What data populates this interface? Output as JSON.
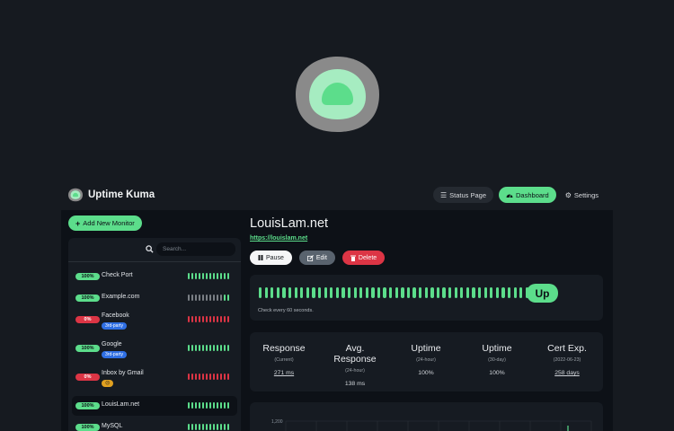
{
  "app": {
    "name": "Uptime Kuma"
  },
  "nav": {
    "status_page": "Status Page",
    "dashboard": "Dashboard",
    "settings": "Settings"
  },
  "sidebar": {
    "add_button": "Add New Monitor",
    "search_placeholder": "Search...",
    "monitors": [
      {
        "name": "Check Port",
        "uptime": "100%",
        "status": "up",
        "tag": null,
        "bars": [
          "up",
          "up",
          "up",
          "up",
          "up",
          "up",
          "up",
          "up",
          "up",
          "up",
          "up",
          "up"
        ]
      },
      {
        "name": "Example.com",
        "uptime": "100%",
        "status": "up",
        "tag": null,
        "bars": [
          "gray",
          "gray",
          "gray",
          "gray",
          "gray",
          "gray",
          "gray",
          "gray",
          "gray",
          "gray",
          "up",
          "up"
        ]
      },
      {
        "name": "Facebook",
        "uptime": "0%",
        "status": "down",
        "tag": {
          "label": "3rd-party",
          "color": "#2f6fe4"
        },
        "bars": [
          "down",
          "down",
          "down",
          "down",
          "down",
          "down",
          "down",
          "down",
          "down",
          "down",
          "down",
          "down"
        ]
      },
      {
        "name": "Google",
        "uptime": "100%",
        "status": "up",
        "tag": {
          "label": "3rd-party",
          "color": "#2f6fe4"
        },
        "bars": [
          "up",
          "up",
          "up",
          "up",
          "up",
          "up",
          "up",
          "up",
          "up",
          "up",
          "up",
          "up"
        ]
      },
      {
        "name": "Inbox by Gmail",
        "uptime": "0%",
        "status": "down",
        "tag": {
          "label": "☹",
          "color": "#e0a020"
        },
        "bars": [
          "down",
          "down",
          "down",
          "down",
          "down",
          "down",
          "down",
          "down",
          "down",
          "down",
          "down",
          "down"
        ]
      },
      {
        "name": "LouisLam.net",
        "uptime": "100%",
        "status": "up",
        "tag": null,
        "active": true,
        "bars": [
          "up",
          "up",
          "up",
          "up",
          "up",
          "up",
          "up",
          "up",
          "up",
          "up",
          "up",
          "up"
        ]
      },
      {
        "name": "MySQL",
        "uptime": "100%",
        "status": "up",
        "tag": null,
        "bars": [
          "up",
          "up",
          "up",
          "up",
          "up",
          "up",
          "up",
          "up",
          "up",
          "up",
          "up",
          "up"
        ]
      }
    ]
  },
  "detail": {
    "title": "LouisLam.net",
    "url": "https://louislam.net",
    "buttons": {
      "pause": "Pause",
      "edit": "Edit",
      "delete": "Delete"
    },
    "status": "Up",
    "check_note": "Check every 60 seconds.",
    "heartbeat_count": 50,
    "stats": [
      {
        "title": "Response",
        "sub": "(Current)",
        "value": "271 ms",
        "link": true
      },
      {
        "title": "Avg. Response",
        "sub": "(24-hour)",
        "value": "138 ms",
        "link": false
      },
      {
        "title": "Uptime",
        "sub": "(24-hour)",
        "value": "100%",
        "link": false
      },
      {
        "title": "Uptime",
        "sub": "(30-day)",
        "value": "100%",
        "link": false
      },
      {
        "title": "Cert Exp.",
        "sub": "(2022-06-23)",
        "value": "258 days",
        "link": true
      }
    ],
    "chart_y_label": "1,200"
  },
  "colors": {
    "accent": "#5cdd8b",
    "danger": "#dc3545",
    "maintenance": "#7a7f85",
    "background": "#0d1117",
    "card": "#161b22"
  },
  "icons": {
    "logo": "uptime-kuma-logo",
    "status_page": "list-icon",
    "dashboard": "gauge-icon",
    "settings": "gear-icon",
    "add": "plus-icon",
    "search": "search-icon",
    "pause": "pause-icon",
    "edit": "edit-icon",
    "delete": "trash-icon"
  }
}
